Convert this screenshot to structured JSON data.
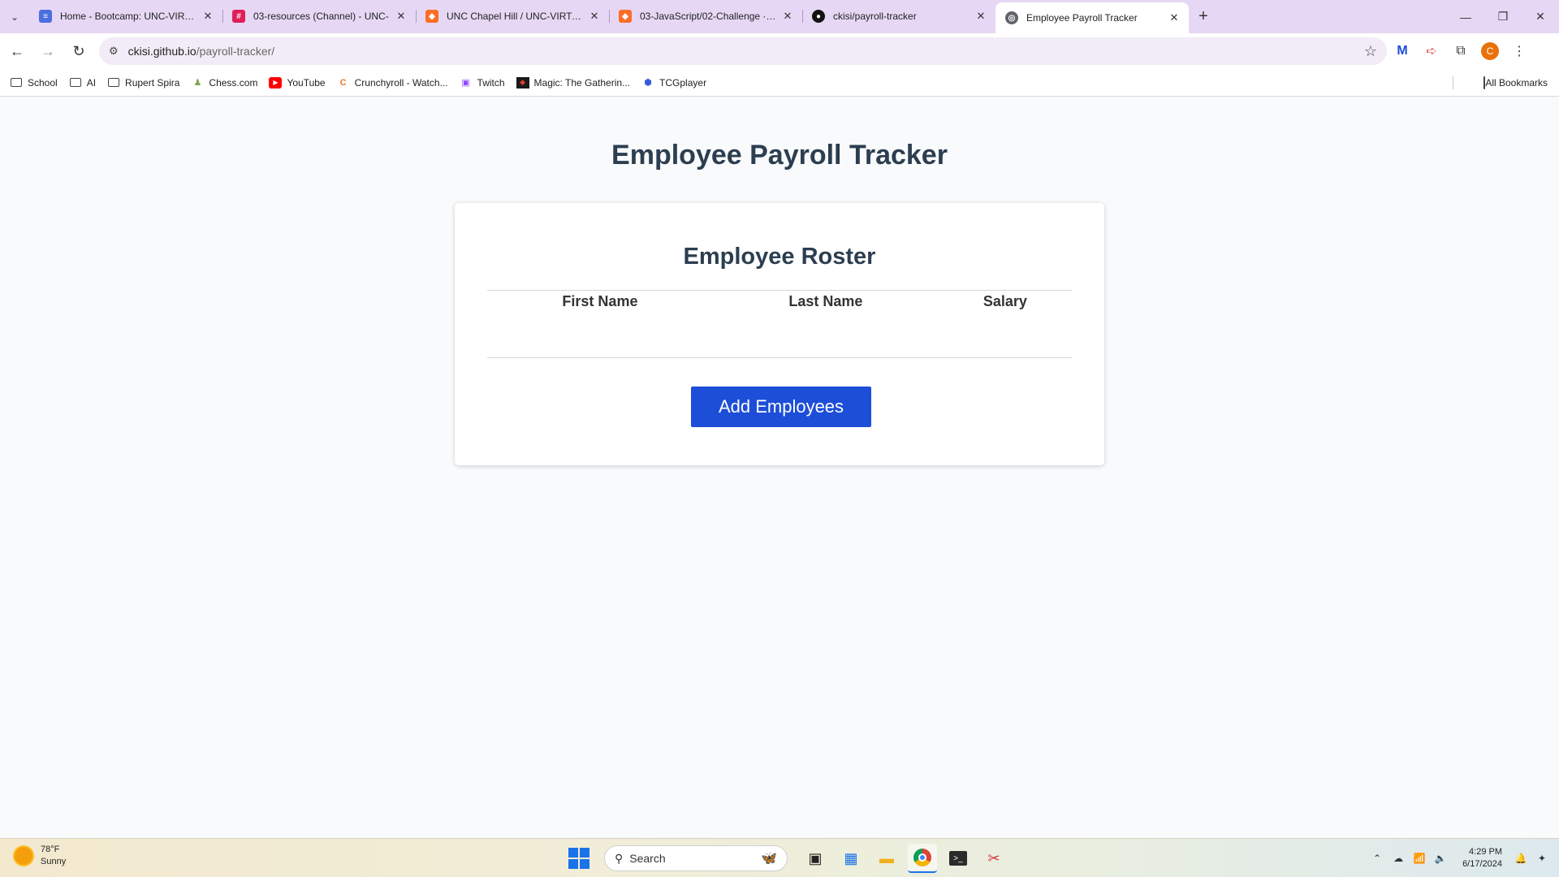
{
  "browser": {
    "tabs": [
      {
        "title": "Home - Bootcamp: UNC-VIRT-F",
        "icon_color": "#4a6fe0",
        "icon": "doc-icon"
      },
      {
        "title": "03-resources (Channel) - UNC-",
        "icon_color": "#e01e5a",
        "icon": "slack-icon"
      },
      {
        "title": "UNC Chapel Hill / UNC-VIRT-FS",
        "icon_color": "#fc6d26",
        "icon": "gitlab-icon"
      },
      {
        "title": "03-JavaScript/02-Challenge · m",
        "icon_color": "#fc6d26",
        "icon": "gitlab-icon"
      },
      {
        "title": "ckisi/payroll-tracker",
        "icon_color": "#111111",
        "icon": "github-icon"
      },
      {
        "title": "Employee Payroll Tracker",
        "icon_color": "#5f6368",
        "icon": "globe-icon",
        "active": true
      }
    ],
    "url_host": "ckisi.github.io",
    "url_path": "/payroll-tracker/",
    "profile_initial": "C",
    "bookmarks": [
      {
        "label": "School",
        "icon": "folder-icon"
      },
      {
        "label": "AI",
        "icon": "folder-icon"
      },
      {
        "label": "Rupert Spira",
        "icon": "folder-icon"
      },
      {
        "label": "Chess.com",
        "icon": "chess-icon"
      },
      {
        "label": "YouTube",
        "icon": "youtube-icon"
      },
      {
        "label": "Crunchyroll - Watch...",
        "icon": "crunchyroll-icon"
      },
      {
        "label": "Twitch",
        "icon": "twitch-icon"
      },
      {
        "label": "Magic: The Gatherin...",
        "icon": "magic-icon"
      },
      {
        "label": "TCGplayer",
        "icon": "tcgplayer-icon"
      }
    ],
    "all_bookmarks_label": "All Bookmarks"
  },
  "page": {
    "title": "Employee Payroll Tracker",
    "roster": {
      "heading": "Employee Roster",
      "columns": [
        "First Name",
        "Last Name",
        "Salary"
      ],
      "rows": []
    },
    "add_button_label": "Add Employees",
    "accent_color": "#1d4ed8"
  },
  "taskbar": {
    "weather_temp": "78°F",
    "weather_desc": "Sunny",
    "search_placeholder": "Search",
    "time": "4:29 PM",
    "date": "6/17/2024"
  }
}
